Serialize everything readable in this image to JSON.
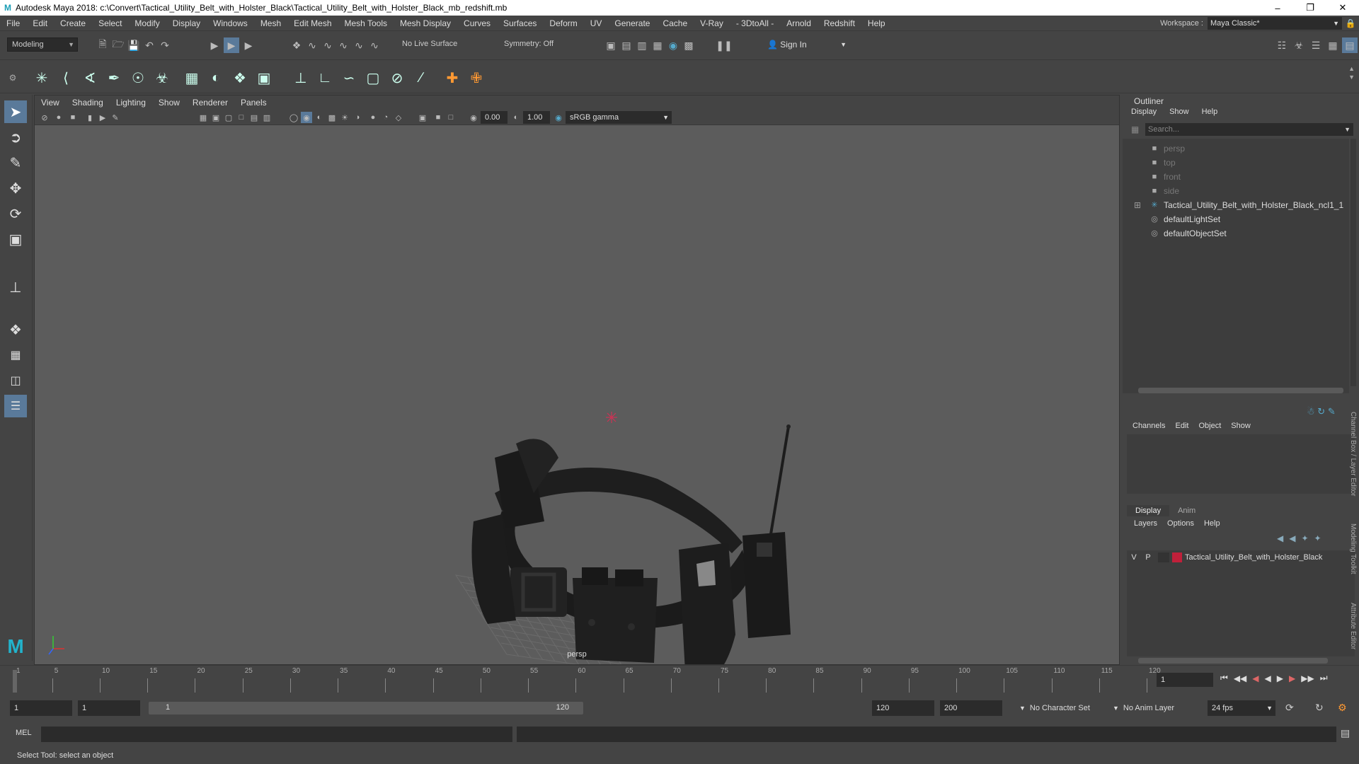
{
  "title": "Autodesk Maya 2018: c:\\Convert\\Tactical_Utility_Belt_with_Holster_Black\\Tactical_Utility_Belt_with_Holster_Black_mb_redshift.mb",
  "menus": [
    "File",
    "Edit",
    "Create",
    "Select",
    "Modify",
    "Display",
    "Windows",
    "Mesh",
    "Edit Mesh",
    "Mesh Tools",
    "Mesh Display",
    "Curves",
    "Surfaces",
    "Deform",
    "UV",
    "Generate",
    "Cache",
    "V-Ray",
    "- 3DtoAll -",
    "Arnold",
    "Redshift",
    "Help"
  ],
  "workspace": {
    "label": "Workspace :",
    "value": "Maya Classic*"
  },
  "toolbar": {
    "mode": "Modeling",
    "live_surface": "No Live Surface",
    "symmetry": "Symmetry: Off",
    "sign_in": "Sign In"
  },
  "viewport": {
    "menus": [
      "View",
      "Shading",
      "Lighting",
      "Show",
      "Renderer",
      "Panels"
    ],
    "exposure": "0.00",
    "gamma": "1.00",
    "color_space": "sRGB gamma",
    "camera_label": "persp"
  },
  "outliner": {
    "title": "Outliner",
    "menus": [
      "Display",
      "Show",
      "Help"
    ],
    "search_placeholder": "Search...",
    "items": [
      {
        "label": "persp",
        "icon": "camera-icon",
        "dim": true
      },
      {
        "label": "top",
        "icon": "camera-icon",
        "dim": true
      },
      {
        "label": "front",
        "icon": "camera-icon",
        "dim": true
      },
      {
        "label": "side",
        "icon": "camera-icon",
        "dim": true
      },
      {
        "label": "Tactical_Utility_Belt_with_Holster_Black_ncl1_1",
        "icon": "transform-icon",
        "dim": false
      },
      {
        "label": "defaultLightSet",
        "icon": "set-icon",
        "dim": false
      },
      {
        "label": "defaultObjectSet",
        "icon": "set-icon",
        "dim": false
      }
    ]
  },
  "channel_box": {
    "menus": [
      "Channels",
      "Edit",
      "Object",
      "Show"
    ]
  },
  "layer_editor": {
    "tabs": [
      "Display",
      "Anim"
    ],
    "menus": [
      "Layers",
      "Options",
      "Help"
    ],
    "layer": {
      "v": "V",
      "p": "P",
      "name": "Tactical_Utility_Belt_with_Holster_Black",
      "color": "#c0203a"
    }
  },
  "side_tabs": [
    "Channel Box / Layer Editor",
    "Modeling Toolkit",
    "Attribute Editor"
  ],
  "timeline": {
    "ticks": [
      "1",
      "5",
      "10",
      "15",
      "20",
      "25",
      "30",
      "35",
      "40",
      "45",
      "50",
      "55",
      "60",
      "65",
      "70",
      "75",
      "80",
      "85",
      "90",
      "95",
      "100",
      "105",
      "110",
      "115",
      "120"
    ],
    "current_frame": "1"
  },
  "range": {
    "start": "1",
    "anim_start": "1",
    "slider_start": "1",
    "slider_end": "120",
    "anim_end": "120",
    "end": "200",
    "character_set": "No Character Set",
    "anim_layer": "No Anim Layer",
    "fps": "24 fps"
  },
  "command": {
    "label": "MEL"
  },
  "help_line": "Select Tool: select an object",
  "colors": {
    "pivot": "#cc3355",
    "layer_color": "#c0203a",
    "bg": "#444444",
    "viewport": "#5c5c5c"
  }
}
